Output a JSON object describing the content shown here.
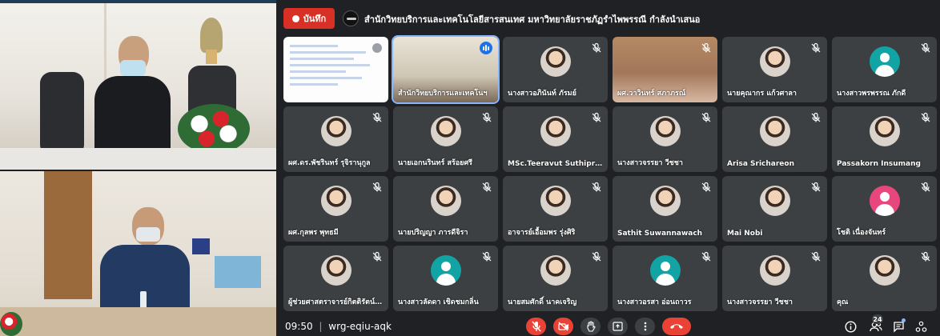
{
  "recording": {
    "label": "บันทึก"
  },
  "presenter": {
    "text": "สำนักวิทยบริการและเทคโนโลยีสารสนเทศ มหาวิทยาลัยราชภัฏรำไพพรรณี กำลังนำเสนอ"
  },
  "participants": [
    {
      "name": "",
      "kind": "screen"
    },
    {
      "name": "สำนักวิทยบริการและเทคโนฯ",
      "kind": "room"
    },
    {
      "name": "นางสาวอภินันท์ ภัรมย์",
      "kind": "photo"
    },
    {
      "name": "ผศ.วาวินทร์ สภาภรณ์",
      "kind": "camera"
    },
    {
      "name": "นายคุณากร แก้วศาลา",
      "kind": "photo"
    },
    {
      "name": "นางสาวพรพรรณ ภักดี",
      "kind": "default"
    },
    {
      "name": "ผศ.ดร.พัชรินทร์ รุจิรานุกูล",
      "kind": "photo"
    },
    {
      "name": "นายเอกนรินทร์ สร้อยศรี",
      "kind": "photo"
    },
    {
      "name": "MSc.Teeravut Suthiprab...",
      "kind": "photo"
    },
    {
      "name": "นางสาวจรรยา วีชชา",
      "kind": "photo"
    },
    {
      "name": "Arisa Srichareon",
      "kind": "photo"
    },
    {
      "name": "Passakorn Insumang",
      "kind": "photo"
    },
    {
      "name": "ผศ.กุลพร พุทธมี",
      "kind": "photo"
    },
    {
      "name": "นายปริญญา ภารดีจิรา",
      "kind": "photo"
    },
    {
      "name": "อาจารย์เอื้อมพร รุ่งศิริ",
      "kind": "photo"
    },
    {
      "name": "Sathit Suwannawach",
      "kind": "photo"
    },
    {
      "name": "Mai Nobi",
      "kind": "photo"
    },
    {
      "name": "โชติ เนื่องจันทร์",
      "kind": "pink"
    },
    {
      "name": "ผู้ช่วยศาสตราจารย์กิตติรัตน์ ...",
      "kind": "photo"
    },
    {
      "name": "นางสาวลัดดา เชิดชมกลิ่น",
      "kind": "default"
    },
    {
      "name": "นายสมศักดิ์ นาคเจริญ",
      "kind": "photo"
    },
    {
      "name": "นางสาวอรสา อ่อนถาวร",
      "kind": "default"
    },
    {
      "name": "นางสาวจรรยา วีชชา",
      "kind": "photo"
    },
    {
      "name": "คุณ",
      "kind": "photo"
    }
  ],
  "meeting": {
    "time": "09:50",
    "separator": "|",
    "code": "wrg-eqiu-aqk"
  },
  "people_count": "24",
  "colors": {
    "accent": "#8ab4f8",
    "danger": "#ea4335",
    "tile": "#3c4043",
    "bg": "#202124"
  }
}
